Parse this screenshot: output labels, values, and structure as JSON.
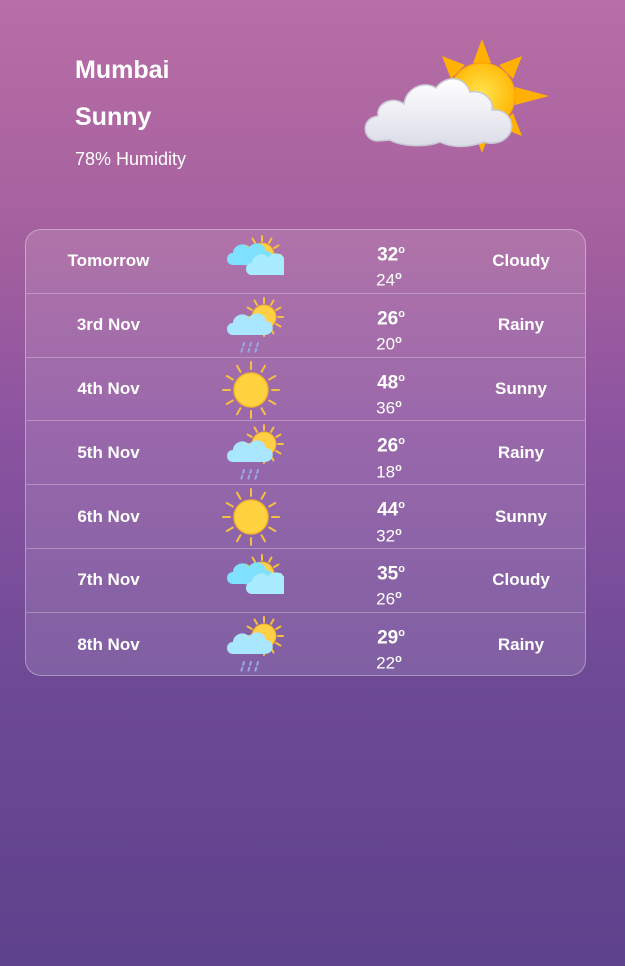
{
  "current": {
    "city": "Mumbai",
    "condition": "Sunny",
    "humidity": "78% Humidity",
    "icon": "sun-behind-cloud-icon"
  },
  "degree_symbol": "o",
  "forecast": [
    {
      "day": "Tomorrow",
      "high": "32",
      "low": "24",
      "condition": "Cloudy",
      "icon": "sun-cloud-icon"
    },
    {
      "day": "3rd Nov",
      "high": "26",
      "low": "20",
      "condition": "Rainy",
      "icon": "sun-cloud-rain-icon"
    },
    {
      "day": "4th Nov",
      "high": "48",
      "low": "36",
      "condition": "Sunny",
      "icon": "sun-icon"
    },
    {
      "day": "5th Nov",
      "high": "26",
      "low": "18",
      "condition": "Rainy",
      "icon": "sun-cloud-rain-icon"
    },
    {
      "day": "6th Nov",
      "high": "44",
      "low": "32",
      "condition": "Sunny",
      "icon": "sun-icon"
    },
    {
      "day": "7th Nov",
      "high": "35",
      "low": "26",
      "condition": "Cloudy",
      "icon": "sun-cloud-icon"
    },
    {
      "day": "8th Nov",
      "high": "29",
      "low": "22",
      "condition": "Rainy",
      "icon": "sun-cloud-rain-icon"
    }
  ]
}
